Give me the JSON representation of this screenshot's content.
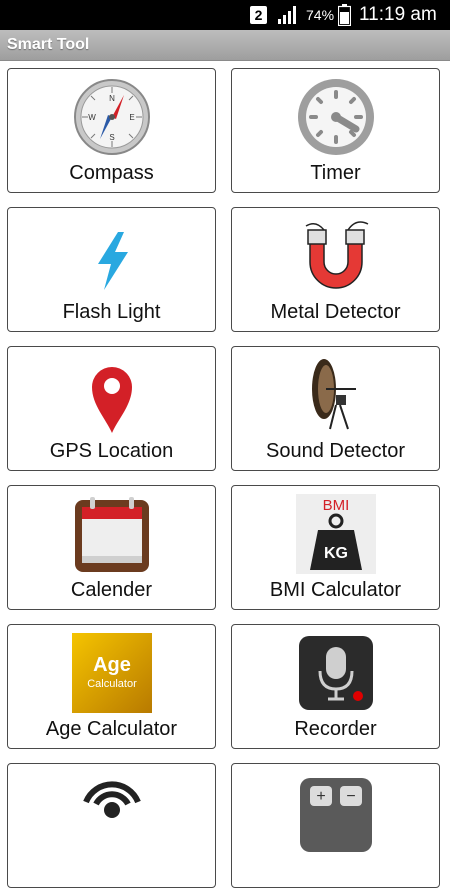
{
  "status_bar": {
    "sim_slot": "2",
    "battery_percent": "74%",
    "time": "11:19 am"
  },
  "app_bar": {
    "title": "Smart Tool"
  },
  "tiles": [
    {
      "label": "Compass",
      "icon": "compass-icon"
    },
    {
      "label": "Timer",
      "icon": "timer-icon"
    },
    {
      "label": "Flash Light",
      "icon": "flashlight-icon"
    },
    {
      "label": "Metal Detector",
      "icon": "magnet-icon"
    },
    {
      "label": "GPS Location",
      "icon": "location-pin-icon"
    },
    {
      "label": "Sound Detector",
      "icon": "satellite-dish-icon"
    },
    {
      "label": "Calender",
      "icon": "calendar-icon"
    },
    {
      "label": "BMI Calculator",
      "icon": "bmi-weight-icon",
      "icon_text_top": "BMI",
      "icon_text_weight": "KG"
    },
    {
      "label": "Age Calculator",
      "icon": "age-calculator-icon",
      "icon_text_main": "Age",
      "icon_text_sub": "Calculator"
    },
    {
      "label": "Recorder",
      "icon": "microphone-icon"
    },
    {
      "label": "",
      "icon": "alarm-icon"
    },
    {
      "label": "",
      "icon": "calculator-icon"
    }
  ],
  "colors": {
    "status_bar": "#000000",
    "app_bar": "#a9a9a9",
    "tile_border": "#4a4a4a",
    "flash": "#29a8e0",
    "pin": "#d32027",
    "magnet": "#e53935",
    "recorder_dot": "#e00000"
  }
}
